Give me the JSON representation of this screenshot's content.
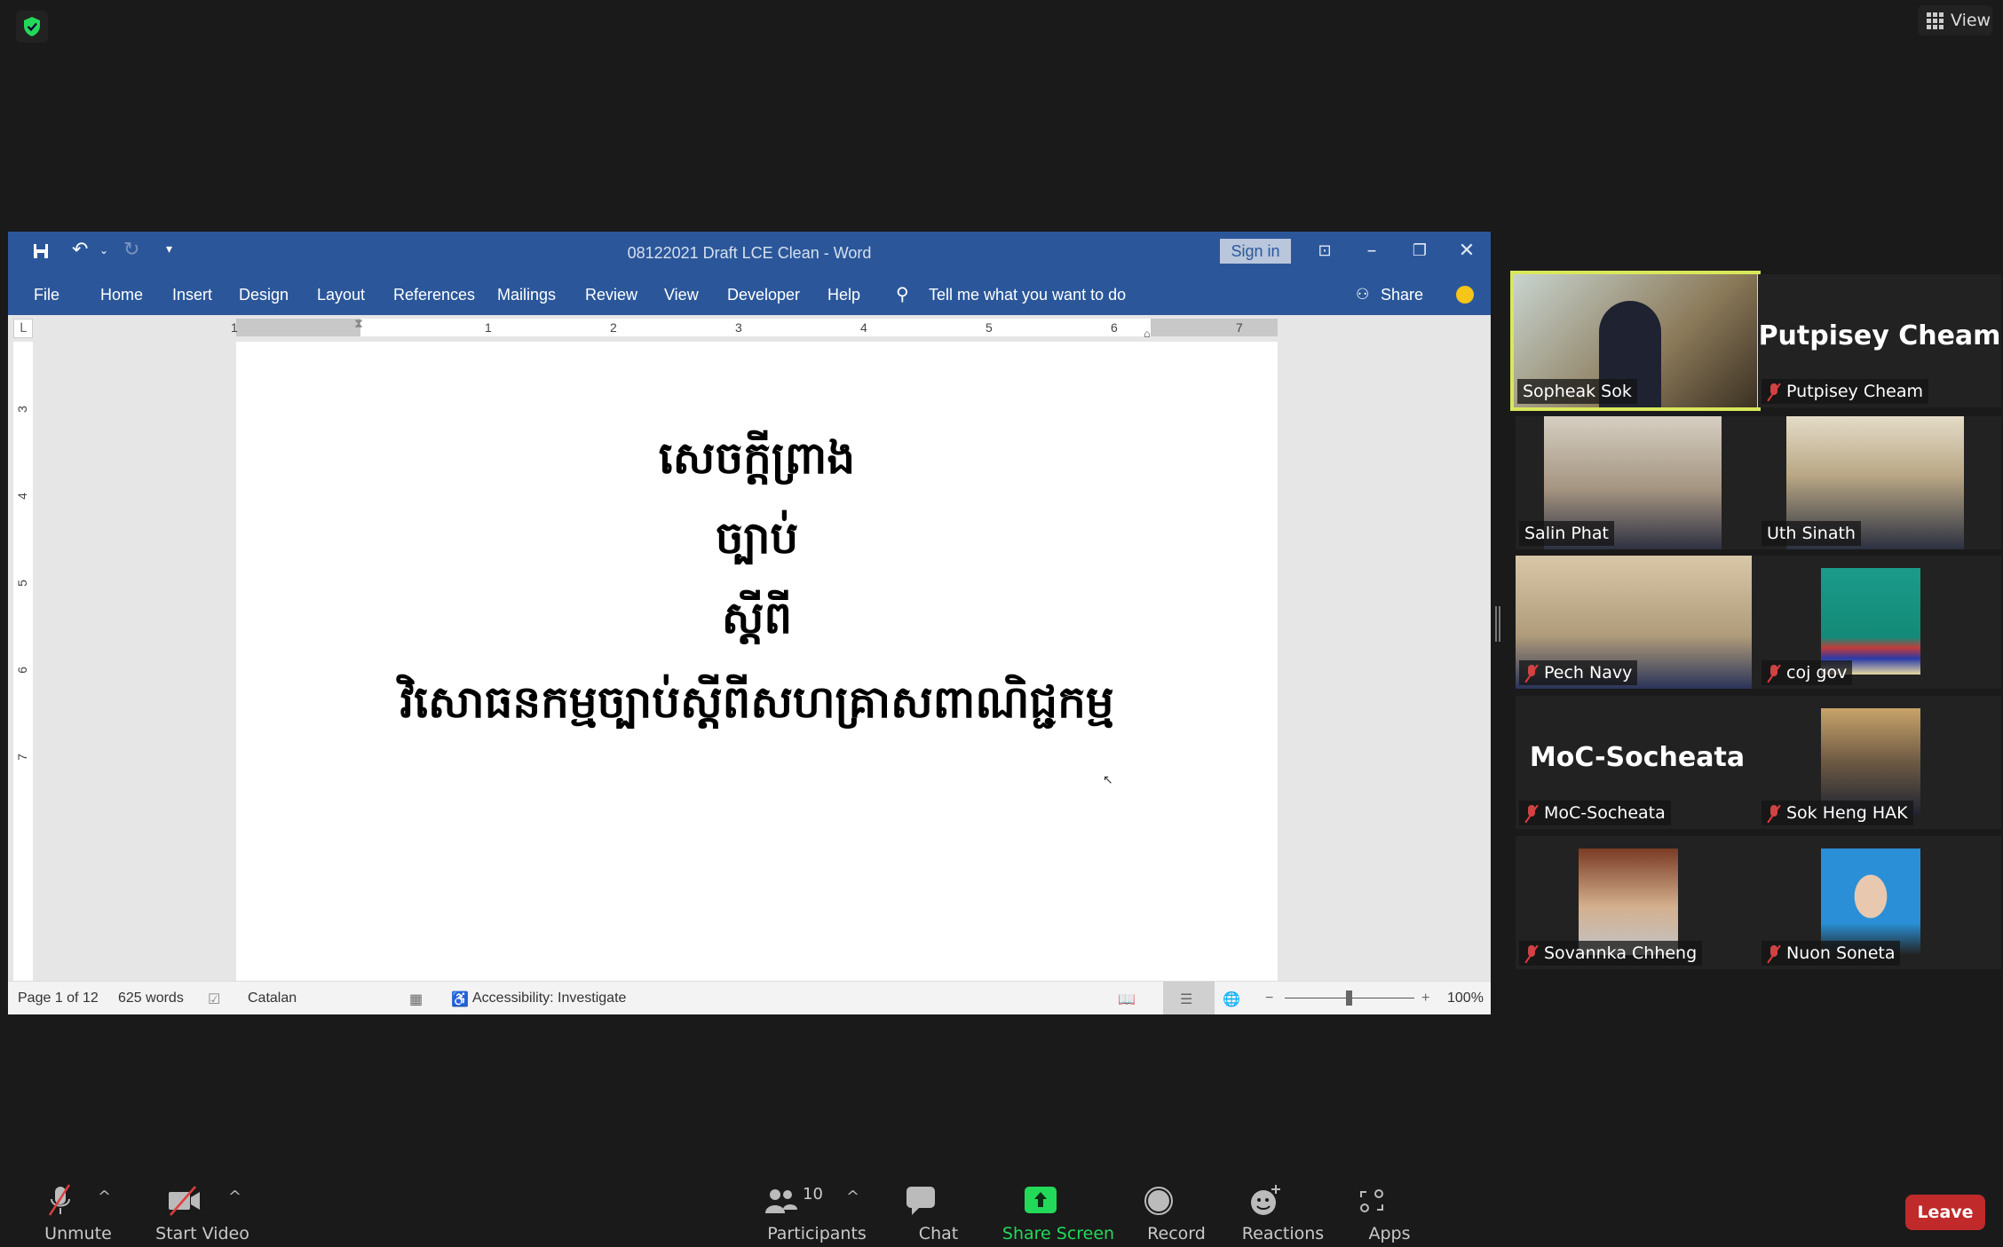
{
  "zoom_overlay": {
    "security_icon": "shield-check-icon",
    "view_button_label": "View"
  },
  "word": {
    "title": "08122021 Draft LCE Clean  -  Word",
    "sign_in_label": "Sign in",
    "quick_access": [
      "save-icon",
      "undo-icon",
      "redo-icon",
      "customize-icon"
    ],
    "window_controls": [
      "ribbon-display-options",
      "minimize",
      "restore",
      "close"
    ],
    "ribbon_tabs": [
      "File",
      "Home",
      "Insert",
      "Design",
      "Layout",
      "References",
      "Mailings",
      "Review",
      "View",
      "Developer",
      "Help"
    ],
    "tell_me": "Tell me what you want to do",
    "share_label": "Share",
    "ruler_numbers": [
      "1",
      "1",
      "2",
      "3",
      "4",
      "5",
      "6",
      "7"
    ],
    "vruler_numbers": [
      "3",
      "4",
      "5",
      "6",
      "7"
    ],
    "document_lines": [
      "សេចក្តីព្រាង",
      "ច្បាប់",
      "ស្តីពី",
      "វិសោធនកម្មច្បាប់ស្តីពីសហគ្រាសពាណិជ្ជកម្ម"
    ],
    "status": {
      "page": "Page 1 of 12",
      "words": "625 words",
      "language": "Catalan",
      "accessibility": "Accessibility: Investigate",
      "zoom": "100%",
      "zoom_level_percent": 100
    }
  },
  "participants": [
    {
      "name": "Sopheak Sok",
      "muted": false,
      "video": true,
      "active_speaker": true
    },
    {
      "name": "Putpisey Cheam",
      "muted": true,
      "video": false,
      "big_label": "Putpisey Cheam"
    },
    {
      "name": "Salin Phat",
      "muted": false,
      "video": true
    },
    {
      "name": "Uth Sinath",
      "muted": false,
      "video": true
    },
    {
      "name": "Pech Navy",
      "muted": true,
      "video": true
    },
    {
      "name": "coj gov",
      "muted": true,
      "video": true
    },
    {
      "name": "MoC-Socheata",
      "muted": true,
      "video": false,
      "big_label": "MoC-Socheata"
    },
    {
      "name": "Sok Heng HAK",
      "muted": true,
      "video": true
    },
    {
      "name": "Sovannka Chheng",
      "muted": true,
      "video": true
    },
    {
      "name": "Nuon Soneta",
      "muted": true,
      "video": true
    }
  ],
  "toolbar": {
    "unmute": "Unmute",
    "start_video": "Start Video",
    "participants": "Participants",
    "participants_count": "10",
    "chat": "Chat",
    "share_screen": "Share Screen",
    "record": "Record",
    "reactions": "Reactions",
    "apps": "Apps",
    "leave": "Leave"
  },
  "colors": {
    "word_blue": "#2b579a",
    "share_green": "#23d959",
    "leave_red": "#c02a2a",
    "speaker_highlight": "#d9e85a"
  }
}
